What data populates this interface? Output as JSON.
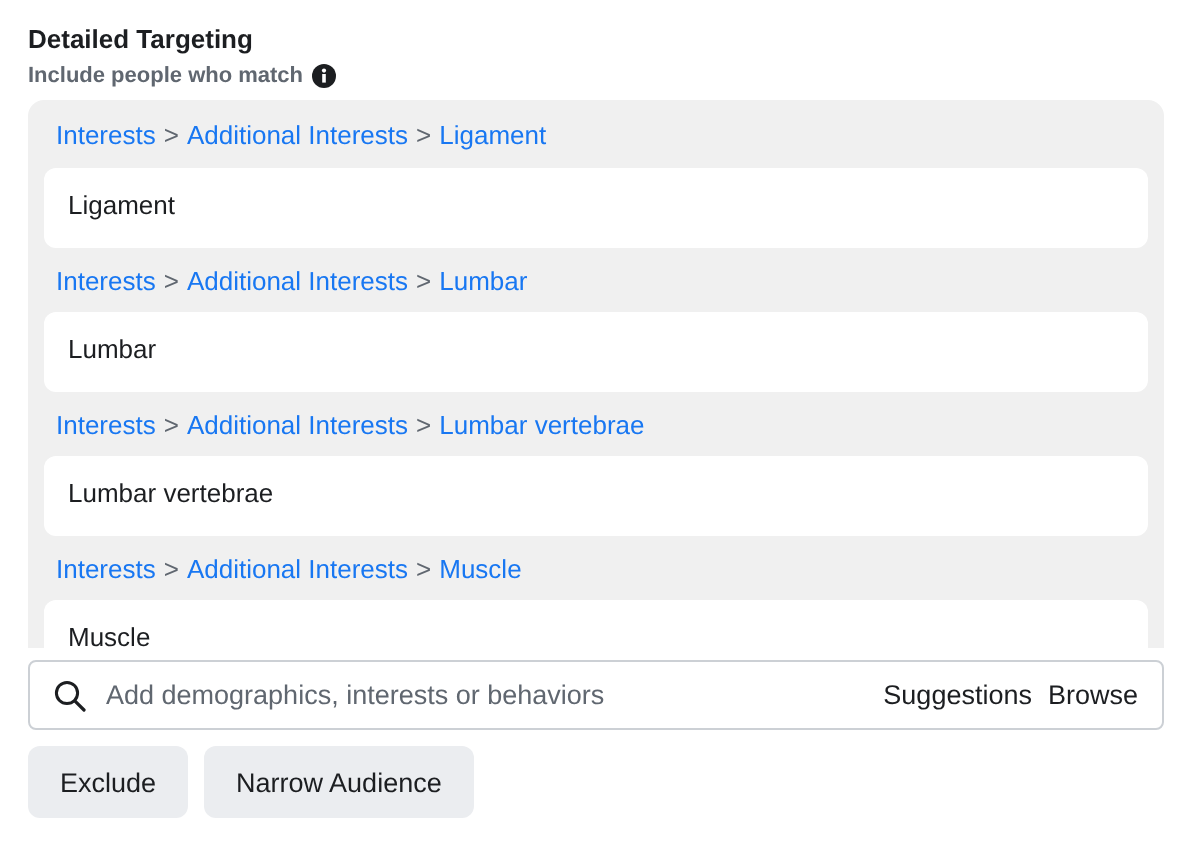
{
  "title": "Detailed Targeting",
  "subtitle": "Include people who match",
  "selections": [
    {
      "breadcrumb": [
        {
          "kind": "link",
          "text": "Interests"
        },
        {
          "kind": "separator",
          "text": ">"
        },
        {
          "kind": "link",
          "text": "Additional Interests"
        },
        {
          "kind": "separator",
          "text": ">"
        },
        {
          "kind": "link",
          "text": "Ligament"
        }
      ],
      "value": "Ligament"
    },
    {
      "breadcrumb": [
        {
          "kind": "link",
          "text": "Interests"
        },
        {
          "kind": "separator",
          "text": ">"
        },
        {
          "kind": "link",
          "text": "Additional Interests"
        },
        {
          "kind": "separator",
          "text": ">"
        },
        {
          "kind": "link",
          "text": "Lumbar"
        }
      ],
      "value": "Lumbar"
    },
    {
      "breadcrumb": [
        {
          "kind": "link",
          "text": "Interests"
        },
        {
          "kind": "separator",
          "text": ">"
        },
        {
          "kind": "link",
          "text": "Additional Interests"
        },
        {
          "kind": "separator",
          "text": ">"
        },
        {
          "kind": "link",
          "text": "Lumbar vertebrae"
        }
      ],
      "value": "Lumbar vertebrae"
    },
    {
      "breadcrumb": [
        {
          "kind": "link",
          "text": "Interests"
        },
        {
          "kind": "separator",
          "text": ">"
        },
        {
          "kind": "link",
          "text": "Additional Interests"
        },
        {
          "kind": "separator",
          "text": ">"
        },
        {
          "kind": "link",
          "text": "Muscle"
        }
      ],
      "value": "Muscle"
    }
  ],
  "search": {
    "placeholder": "Add demographics, interests or behaviors",
    "actions": [
      "Suggestions",
      "Browse"
    ]
  },
  "buttons": [
    "Exclude",
    "Narrow Audience"
  ]
}
